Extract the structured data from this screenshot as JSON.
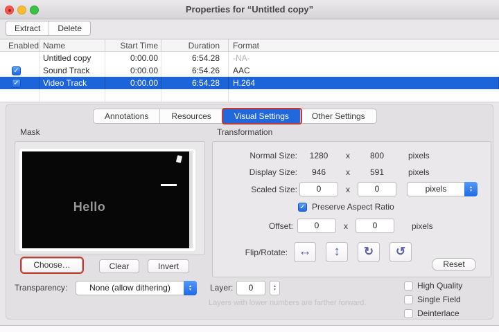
{
  "window": {
    "title": "Properties for “Untitled copy”"
  },
  "toolbar": {
    "extract_label": "Extract",
    "delete_label": "Delete"
  },
  "track_table": {
    "columns": [
      "Enabled",
      "Name",
      "Start Time",
      "Duration",
      "Format"
    ],
    "rows": [
      {
        "enabled": false,
        "name": "Untitled copy",
        "start_time": "0:00.00",
        "duration": "6:54.28",
        "format": "-NA-",
        "selected": false
      },
      {
        "enabled": true,
        "name": "Sound Track",
        "start_time": "0:00.00",
        "duration": "6:54.26",
        "format": "AAC",
        "selected": false
      },
      {
        "enabled": true,
        "name": "Video Track",
        "start_time": "0:00.00",
        "duration": "6:54.28",
        "format": "H.264",
        "selected": true
      }
    ]
  },
  "tabs": {
    "items": [
      {
        "label": "Annotations"
      },
      {
        "label": "Resources"
      },
      {
        "label": "Visual Settings"
      },
      {
        "label": "Other Settings"
      }
    ],
    "selected": "Visual Settings"
  },
  "mask": {
    "title": "Mask",
    "preview_text": "Hello",
    "choose_label": "Choose…",
    "clear_label": "Clear",
    "invert_label": "Invert"
  },
  "transformation": {
    "title": "Transformation",
    "dimension_separator": "x",
    "normal_size": {
      "label": "Normal Size:",
      "width": "1280",
      "height": "800",
      "unit": "pixels"
    },
    "display_size": {
      "label": "Display Size:",
      "width": "946",
      "height": "591",
      "unit": "pixels"
    },
    "scaled_size": {
      "label": "Scaled Size:",
      "width": "0",
      "height": "0",
      "unit_selected": "pixels"
    },
    "preserve_aspect_ratio": {
      "label": "Preserve Aspect Ratio",
      "checked": true
    },
    "offset": {
      "label": "Offset:",
      "x": "0",
      "y": "0",
      "unit": "pixels"
    },
    "flip_rotate": {
      "label": "Flip/Rotate:"
    },
    "reset_label": "Reset"
  },
  "footer": {
    "transparency_label": "Transparency:",
    "transparency_value": "None (allow dithering)",
    "layer_label": "Layer:",
    "layer_value": "0",
    "hint": "Layers with lower numbers are farther forward.",
    "checkboxes": [
      {
        "label": "High Quality",
        "checked": false
      },
      {
        "label": "Single Field",
        "checked": false
      },
      {
        "label": "Deinterlace",
        "checked": false
      }
    ]
  },
  "icons": {
    "checkmark": "✓",
    "flip_horizontal": "↔",
    "flip_vertical": "↕",
    "rotate_clockwise": "↻",
    "rotate_counterclockwise": "↺",
    "arrow_up": "▲",
    "arrow_down": "▼"
  },
  "colors": {
    "selection_blue": "#1c64d9",
    "tab_blue": "#2268dd",
    "annotation_red": "#c53a2c",
    "flip_icon_purple": "#5b61a9",
    "checkbox_blue": "#2f7cf0"
  }
}
